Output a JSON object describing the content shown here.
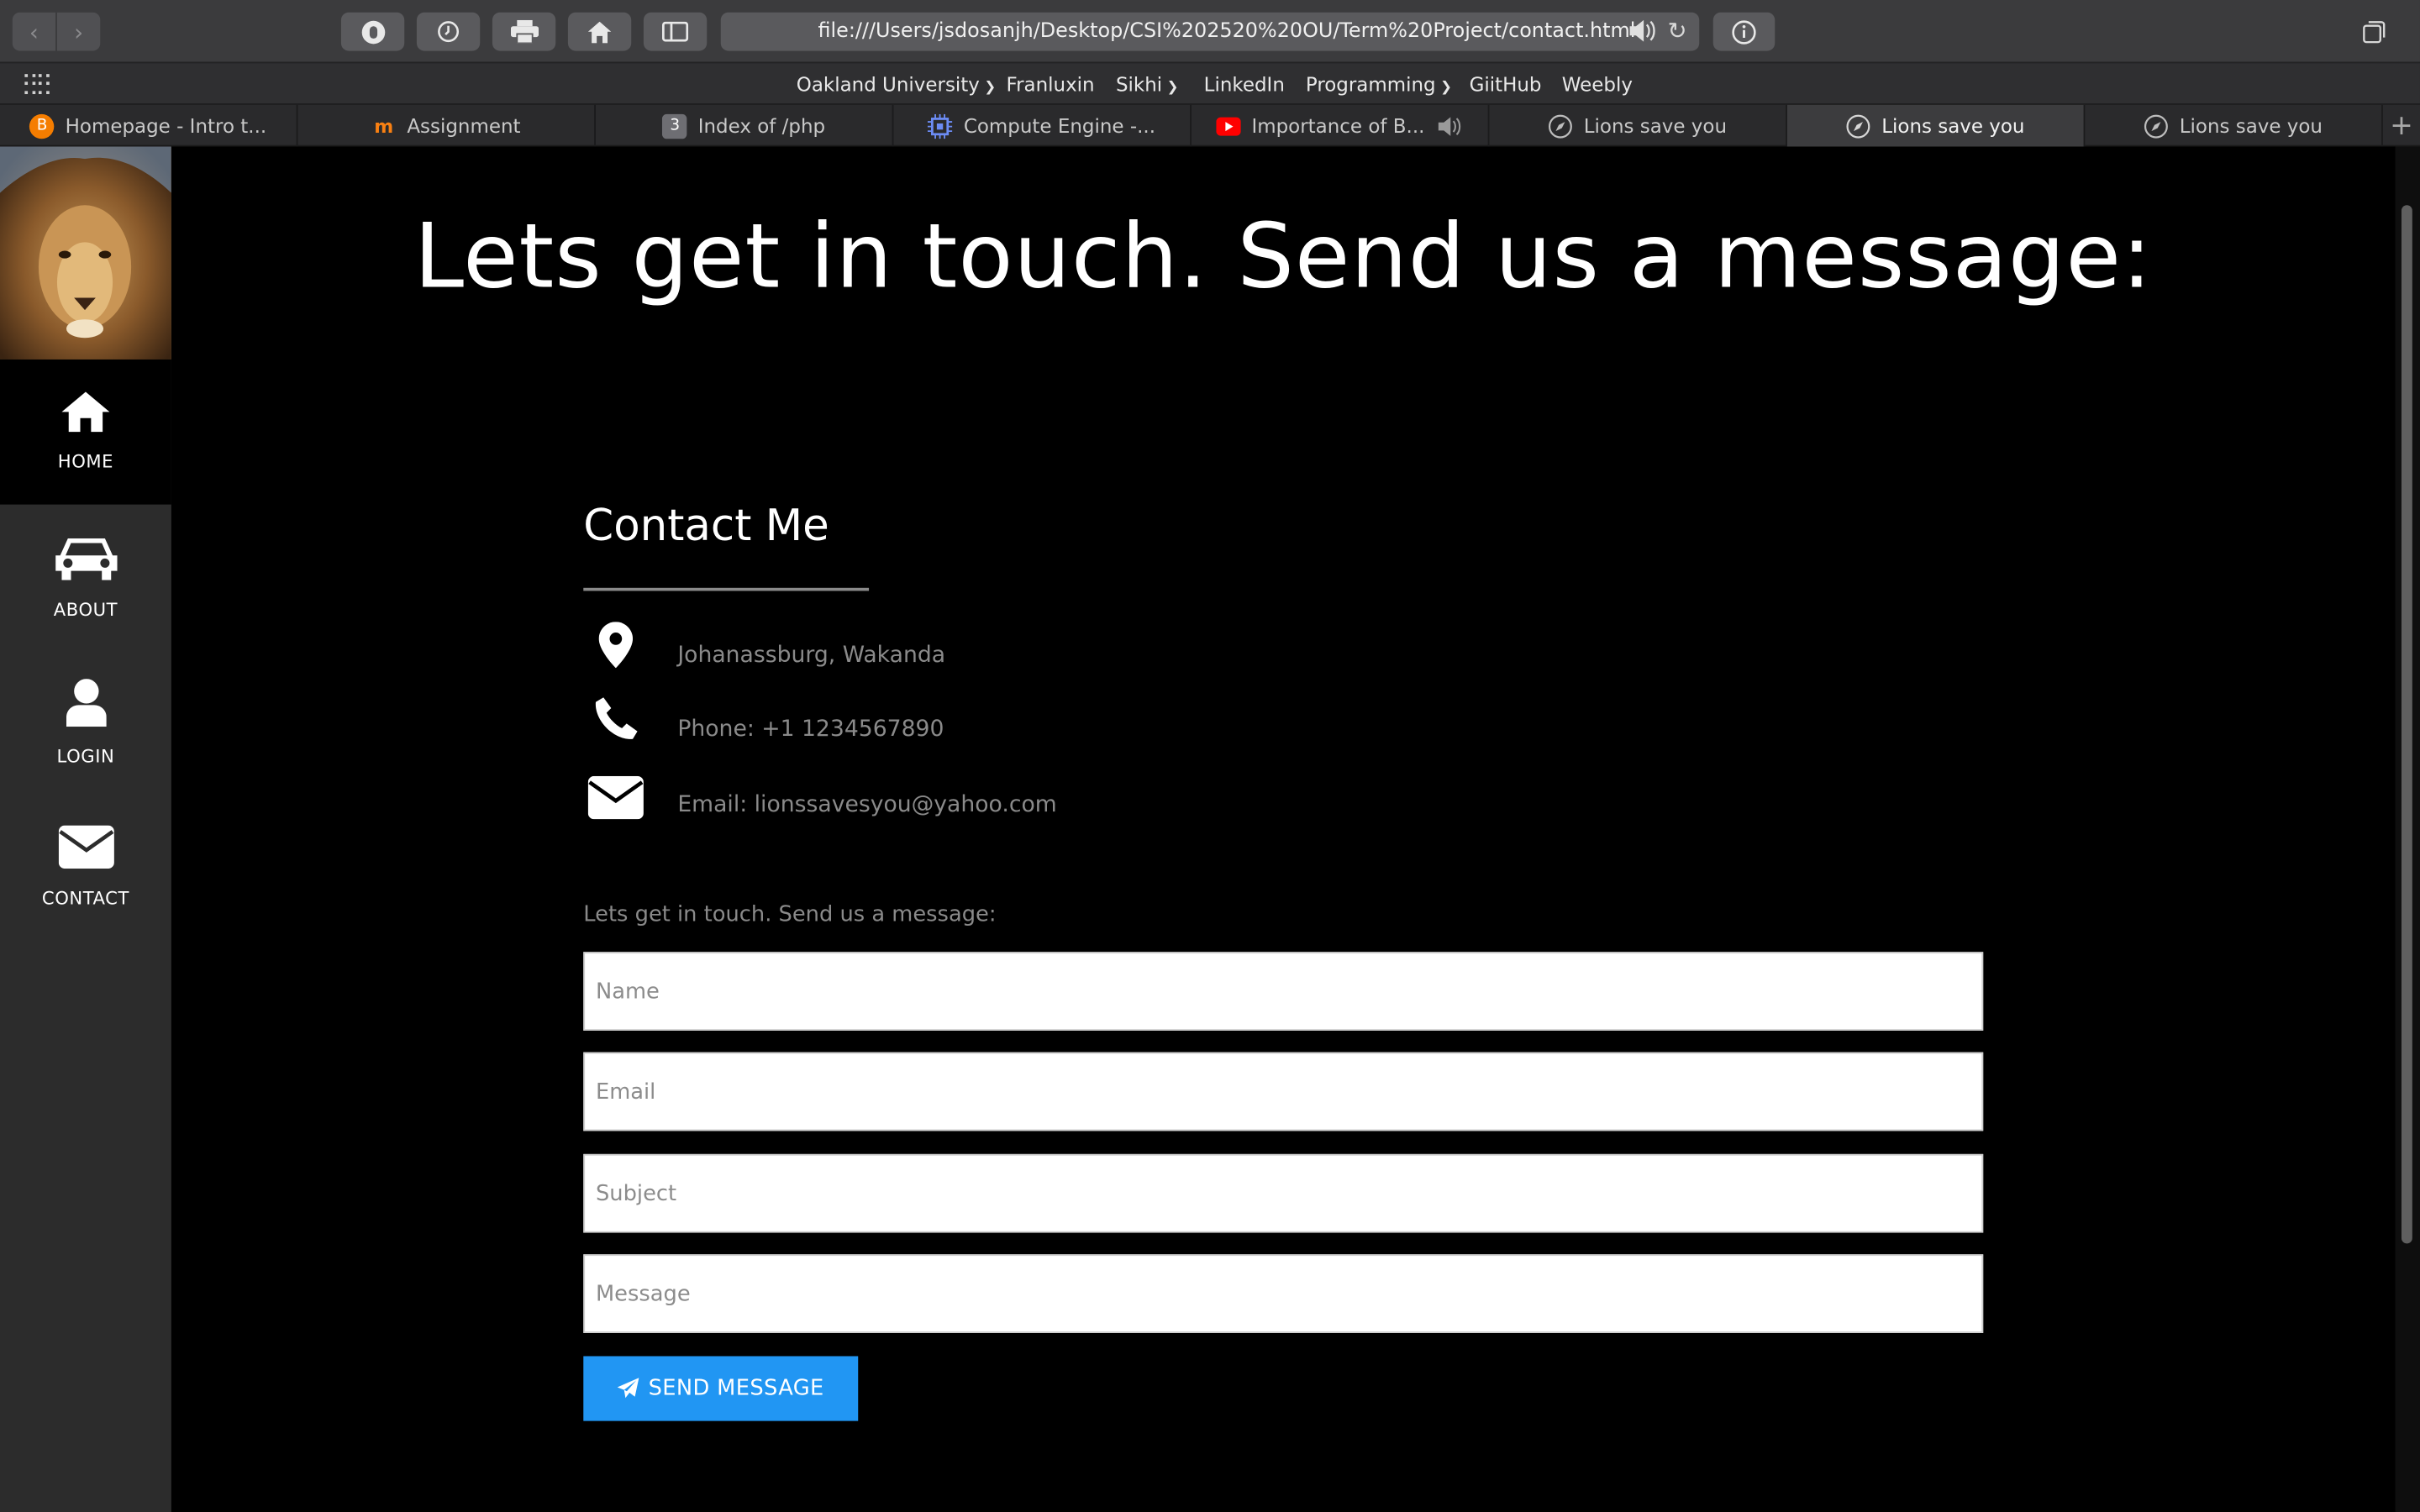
{
  "browser": {
    "url": "file:///Users/jsdosanjh/Desktop/CSI%202520%20OU/Term%20Project/contact.html",
    "bookmarks": [
      {
        "label": "Oakland University",
        "has_menu": true
      },
      {
        "label": "Franluxin",
        "has_menu": false
      },
      {
        "label": "Sikhi",
        "has_menu": true
      },
      {
        "label": "LinkedIn",
        "has_menu": false
      },
      {
        "label": "Programming",
        "has_menu": true
      },
      {
        "label": "GiitHub",
        "has_menu": false
      },
      {
        "label": "Weebly",
        "has_menu": false
      }
    ],
    "tabs": [
      {
        "label": "Homepage - Intro t...",
        "icon": "blogger-icon",
        "color": "#f57d00"
      },
      {
        "label": "Assignment",
        "icon": "moodle-icon",
        "color": "#f98012"
      },
      {
        "label": "Index of /php",
        "icon": "number-3-icon",
        "color": "#6e6e73"
      },
      {
        "label": "Compute Engine -...",
        "icon": "chip-icon",
        "color": "#4a6ee0"
      },
      {
        "label": "Importance of B...",
        "icon": "youtube-icon",
        "color": "#ff0000"
      },
      {
        "label": "Lions save you",
        "icon": "compass-icon",
        "color": "#bdbdbd"
      },
      {
        "label": "Lions save you",
        "icon": "compass-icon",
        "color": "#bdbdbd",
        "active": true
      },
      {
        "label": "Lions save you",
        "icon": "compass-icon",
        "color": "#bdbdbd"
      }
    ]
  },
  "sidebar": {
    "items": [
      {
        "label": "HOME",
        "icon": "home-icon",
        "active": true
      },
      {
        "label": "ABOUT",
        "icon": "car-icon"
      },
      {
        "label": "LOGIN",
        "icon": "user-icon"
      },
      {
        "label": "CONTACT",
        "icon": "envelope-icon"
      }
    ]
  },
  "page": {
    "hero": "Lets get in touch. Send us a message:",
    "contact_title": "Contact Me",
    "info": {
      "address": "Johanassburg, Wakanda",
      "phone": "Phone: +1 1234567890",
      "email": "Email: lionssavesyou@yahoo.com"
    },
    "form": {
      "intro": "Lets get in touch. Send us a message:",
      "name_placeholder": "Name",
      "email_placeholder": "Email",
      "subject_placeholder": "Subject",
      "message_placeholder": "Message",
      "send_label": "SEND MESSAGE"
    },
    "accent": "#2196f3"
  }
}
